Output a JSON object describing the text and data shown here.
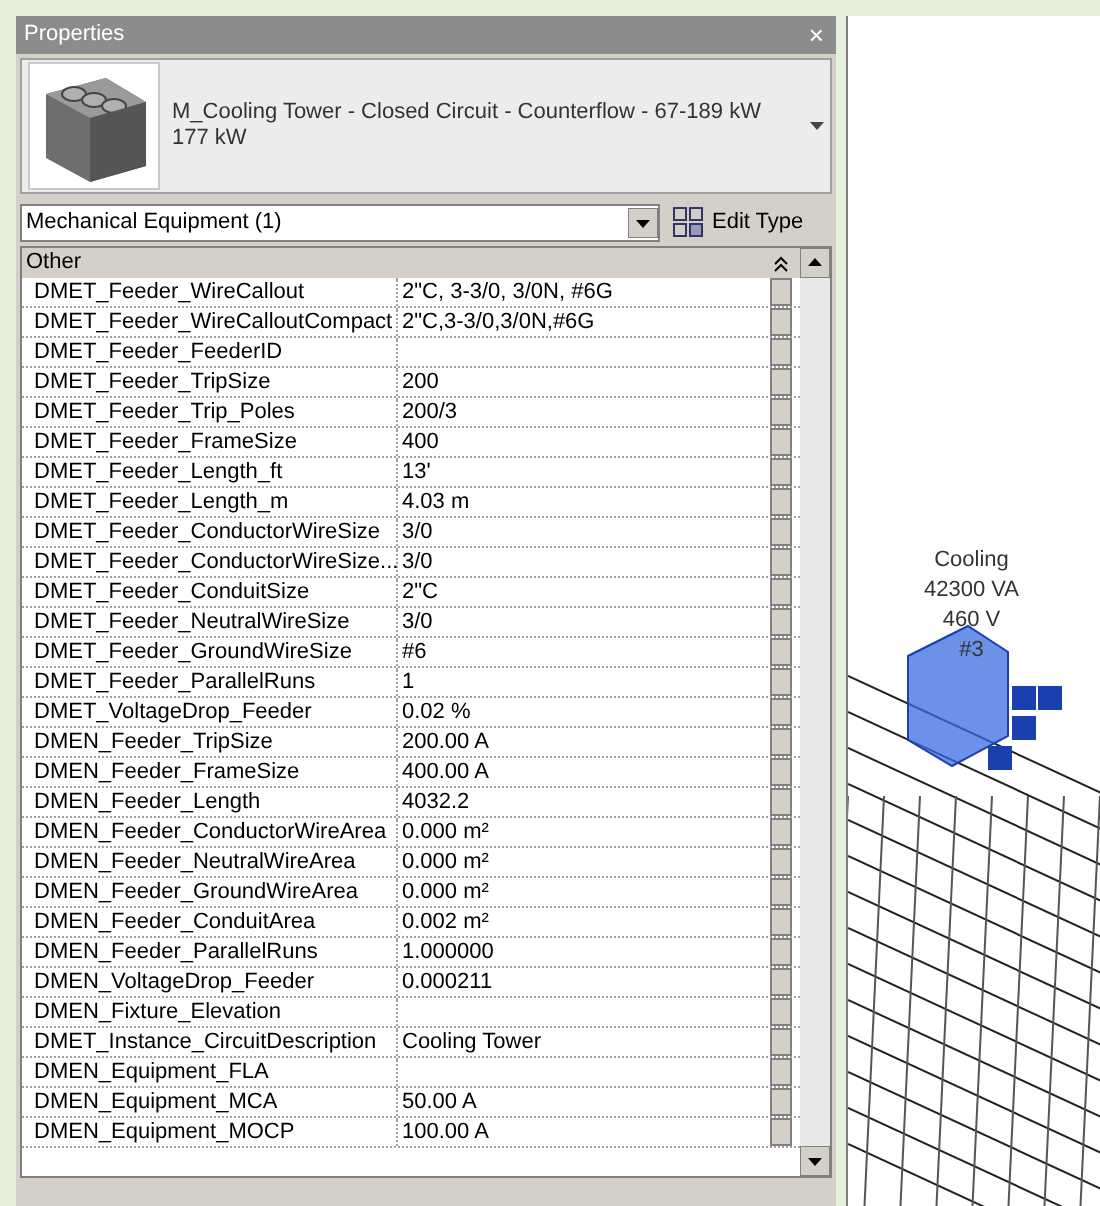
{
  "panel": {
    "title": "Properties",
    "close": "×"
  },
  "type_selector": {
    "name": "M_Cooling Tower - Closed Circuit - Counterflow - 67-189 kW",
    "subtitle": "177 kW"
  },
  "filter": {
    "value": "Mechanical Equipment (1)",
    "edit_type": "Edit Type"
  },
  "group": {
    "title": "Other",
    "expanded": true
  },
  "rows": [
    {
      "name": "DMET_Feeder_WireCallout",
      "value": "2\"C, 3-3/0, 3/0N, #6G"
    },
    {
      "name": "DMET_Feeder_WireCalloutCompact",
      "value": "2\"C,3-3/0,3/0N,#6G"
    },
    {
      "name": "DMET_Feeder_FeederID",
      "value": ""
    },
    {
      "name": "DMET_Feeder_TripSize",
      "value": "200"
    },
    {
      "name": "DMET_Feeder_Trip_Poles",
      "value": "200/3"
    },
    {
      "name": "DMET_Feeder_FrameSize",
      "value": "400"
    },
    {
      "name": "DMET_Feeder_Length_ft",
      "value": "13'"
    },
    {
      "name": "DMET_Feeder_Length_m",
      "value": "4.03 m"
    },
    {
      "name": "DMET_Feeder_ConductorWireSize",
      "value": "3/0"
    },
    {
      "name": "DMET_Feeder_ConductorWireSize...",
      "value": "3/0"
    },
    {
      "name": "DMET_Feeder_ConduitSize",
      "value": "2\"C"
    },
    {
      "name": "DMET_Feeder_NeutralWireSize",
      "value": "3/0"
    },
    {
      "name": "DMET_Feeder_GroundWireSize",
      "value": "#6"
    },
    {
      "name": "DMET_Feeder_ParallelRuns",
      "value": "1"
    },
    {
      "name": "DMET_VoltageDrop_Feeder",
      "value": "0.02 %"
    },
    {
      "name": "DMEN_Feeder_TripSize",
      "value": "200.00 A"
    },
    {
      "name": "DMEN_Feeder_FrameSize",
      "value": "400.00 A"
    },
    {
      "name": "DMEN_Feeder_Length",
      "value": "4032.2"
    },
    {
      "name": "DMEN_Feeder_ConductorWireArea",
      "value": "0.000 m²"
    },
    {
      "name": "DMEN_Feeder_NeutralWireArea",
      "value": "0.000 m²"
    },
    {
      "name": "DMEN_Feeder_GroundWireArea",
      "value": "0.000 m²"
    },
    {
      "name": "DMEN_Feeder_ConduitArea",
      "value": "0.002 m²"
    },
    {
      "name": "DMEN_Feeder_ParallelRuns",
      "value": "1.000000"
    },
    {
      "name": "DMEN_VoltageDrop_Feeder",
      "value": "0.000211"
    },
    {
      "name": "DMEN_Fixture_Elevation",
      "value": ""
    },
    {
      "name": "DMET_Instance_CircuitDescription",
      "value": "Cooling Tower"
    },
    {
      "name": "DMEN_Equipment_FLA",
      "value": ""
    },
    {
      "name": "DMEN_Equipment_MCA",
      "value": "50.00 A"
    },
    {
      "name": "DMEN_Equipment_MOCP",
      "value": "100.00 A"
    }
  ],
  "viewport": {
    "tag_lines": [
      "Cooling",
      "42300 VA",
      "460 V",
      "#3"
    ]
  }
}
